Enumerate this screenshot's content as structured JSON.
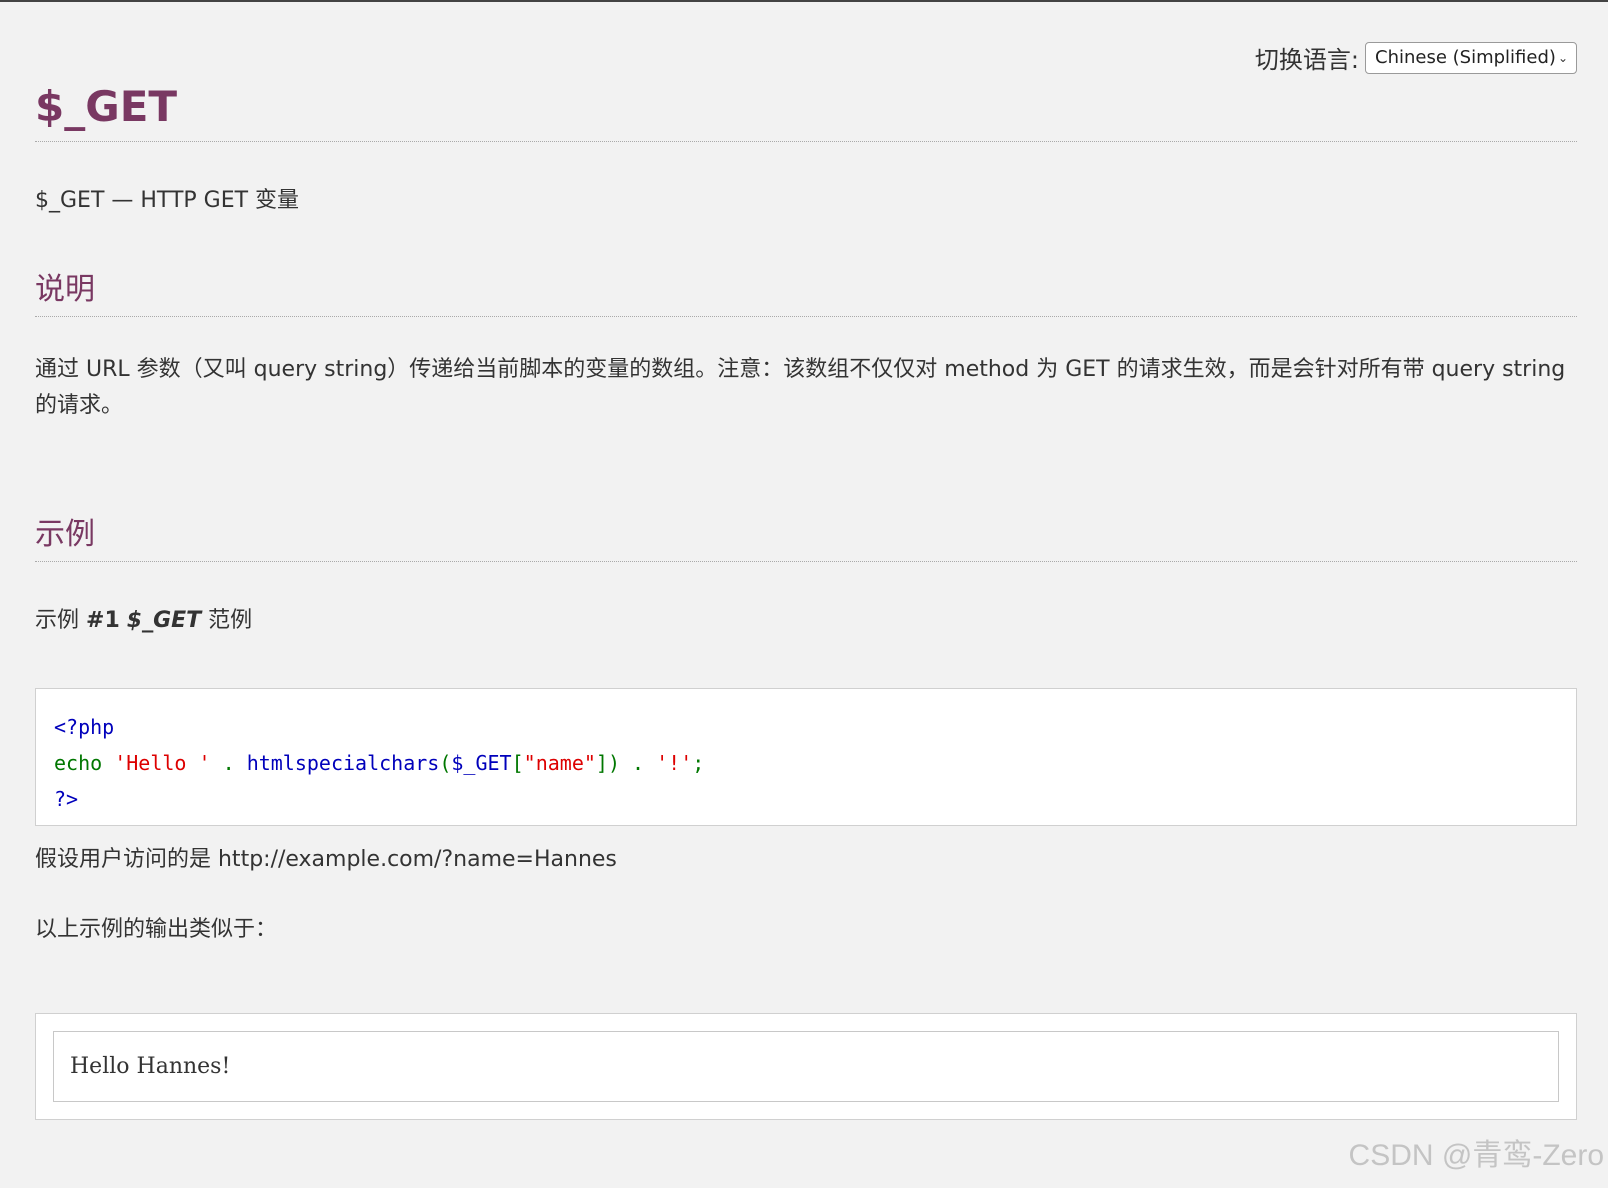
{
  "language_switcher": {
    "label": "切换语言:",
    "selected": "Chinese (Simplified)"
  },
  "page": {
    "title": "$_GET",
    "refpurpose": "$_GET — HTTP GET 变量"
  },
  "description": {
    "heading": "说明",
    "text": "通过 URL 参数（又叫 query string）传递给当前脚本的变量的数组。注意：该数组不仅仅对 method 为 GET 的请求生效，而是会针对所有带 query string 的请求。"
  },
  "examples": {
    "heading": "示例",
    "example_title_prefix": "示例",
    "example_number": "#1",
    "example_var": "$_GET",
    "example_title_suffix": "范例",
    "code": {
      "line1": "<?php",
      "line2_echo": "echo",
      "line2_str1": "'Hello '",
      "line2_dot1": ".",
      "line2_func": "htmlspecialchars",
      "line2_paren_open": "(",
      "line2_var": "$_GET",
      "line2_bracket_open": "[",
      "line2_key": "\"name\"",
      "line2_bracket_close": "])",
      "line2_dot2": ".",
      "line2_str2": "'!'",
      "line2_semi": ";",
      "line3": "?>"
    },
    "assumption": "假设用户访问的是 http://example.com/?name=Hannes",
    "output_intro": "以上示例的输出类似于：",
    "output": "Hello Hannes!"
  },
  "watermark": "CSDN @青鸾-Zero"
}
